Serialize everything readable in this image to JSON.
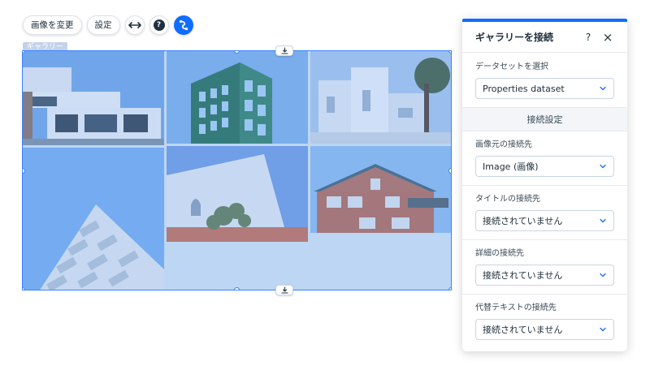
{
  "toolbar": {
    "change_image_label": "画像を変更",
    "settings_label": "設定",
    "help_glyph": "?"
  },
  "gallery": {
    "tag_label": "ギャラリー"
  },
  "panel": {
    "title": "ギャラリーを接続",
    "help_glyph": "?",
    "close_glyph": "×",
    "dataset": {
      "label": "データセットを選択",
      "value": "Properties dataset"
    },
    "connection_settings_title": "接続設定",
    "fields": [
      {
        "label": "画像元の接続先",
        "value": "Image (画像)"
      },
      {
        "label": "タイトルの接続先",
        "value": "接続されていません"
      },
      {
        "label": "詳細の接続先",
        "value": "接続されていません"
      },
      {
        "label": "代替テキストの接続先",
        "value": "接続されていません"
      }
    ]
  },
  "colors": {
    "accent": "#116dff",
    "selection": "#3b84ff"
  }
}
